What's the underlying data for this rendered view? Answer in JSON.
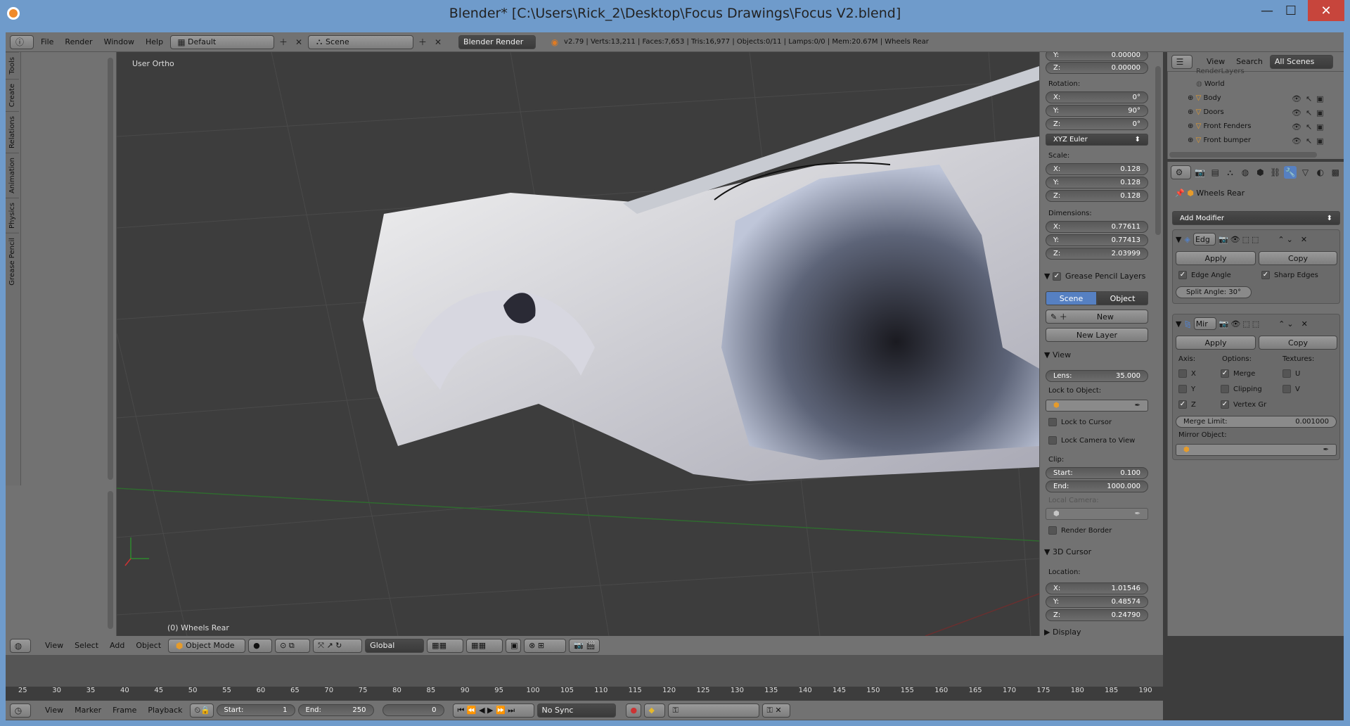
{
  "window": {
    "title": "Blender* [C:\\Users\\Rick_2\\Desktop\\Focus Drawings\\Focus V2.blend]",
    "minimize": "—",
    "maximize": "☐",
    "close": "✕"
  },
  "info_header": {
    "menus": [
      "File",
      "Render",
      "Window",
      "Help"
    ],
    "layout": "Default",
    "scene": "Scene",
    "engine": "Blender Render",
    "stats": "v2.79 | Verts:13,211 | Faces:7,653 | Tris:16,977 | Objects:0/11 | Lamps:0/0 | Mem:20.67M | Wheels Rear"
  },
  "toolshelf_tabs": [
    "Tools",
    "Create",
    "Relations",
    "Animation",
    "Physics",
    "Grease Pencil"
  ],
  "viewport": {
    "view_label": "User Ortho",
    "object_label": "(0) Wheels Rear"
  },
  "npanel": {
    "top_y": "0.00000",
    "top_z": "0.00000",
    "rotation_label": "Rotation:",
    "rotation": [
      {
        "axis": "X:",
        "value": "0°"
      },
      {
        "axis": "Y:",
        "value": "90°"
      },
      {
        "axis": "Z:",
        "value": "0°"
      }
    ],
    "rotation_mode": "XYZ Euler",
    "scale_label": "Scale:",
    "scale": [
      {
        "axis": "X:",
        "value": "0.128"
      },
      {
        "axis": "Y:",
        "value": "0.128"
      },
      {
        "axis": "Z:",
        "value": "0.128"
      }
    ],
    "dimensions_label": "Dimensions:",
    "dimensions": [
      {
        "axis": "X:",
        "value": "0.77611"
      },
      {
        "axis": "Y:",
        "value": "0.77413"
      },
      {
        "axis": "Z:",
        "value": "2.03999"
      }
    ],
    "grease_pencil": "Grease Pencil Layers",
    "scene_btn": "Scene",
    "object_btn": "Object",
    "new_btn": "New",
    "new_layer_btn": "New Layer",
    "view_section": "View",
    "lens_label": "Lens:",
    "lens_value": "35.000",
    "lock_to_object": "Lock to Object:",
    "lock_to_cursor": "Lock to Cursor",
    "lock_camera": "Lock Camera to View",
    "clip_label": "Clip:",
    "clip_start_label": "Start:",
    "clip_start": "0.100",
    "clip_end_label": "End:",
    "clip_end": "1000.000",
    "local_camera": "Local Camera:",
    "render_border": "Render Border",
    "cursor_section": "3D Cursor",
    "location_label": "Location:",
    "cursor": [
      {
        "axis": "X:",
        "value": "1.01546"
      },
      {
        "axis": "Y:",
        "value": "0.48574"
      },
      {
        "axis": "Z:",
        "value": "0.24790"
      }
    ],
    "display_section": "Display"
  },
  "outliner": {
    "view": "View",
    "search": "Search",
    "filter": "All Scenes",
    "items": [
      "RenderLayers",
      "World",
      "Body",
      "Doors",
      "Front Fenders",
      "Front bumper"
    ]
  },
  "properties": {
    "object": "Wheels Rear",
    "add_modifier": "Add Modifier",
    "mod1_name": "Edg",
    "mod2_name": "Mir",
    "apply": "Apply",
    "copy": "Copy",
    "edge_angle": "Edge Angle",
    "sharp_edges": "Sharp Edges",
    "split_angle": "Split Angle: 30°",
    "axis_label": "Axis:",
    "options_label": "Options:",
    "textures_label": "Textures:",
    "axis_x": "X",
    "axis_y": "Y",
    "axis_z": "Z",
    "merge": "Merge",
    "clipping": "Clipping",
    "vertex_gr": "Vertex Gr",
    "tex_u": "U",
    "tex_v": "V",
    "merge_limit_label": "Merge Limit:",
    "merge_limit": "0.001000",
    "mirror_object": "Mirror Object:"
  },
  "view3d_header": {
    "menus": [
      "View",
      "Select",
      "Add",
      "Object"
    ],
    "mode": "Object Mode",
    "orientation": "Global"
  },
  "timeline": {
    "ticks": [
      "25",
      "30",
      "35",
      "40",
      "45",
      "50",
      "55",
      "60",
      "65",
      "70",
      "75",
      "80",
      "85",
      "90",
      "95",
      "100",
      "105",
      "110",
      "115",
      "120",
      "125",
      "130",
      "135",
      "140",
      "145",
      "150",
      "155",
      "160",
      "165",
      "170",
      "175",
      "180",
      "185",
      "190"
    ],
    "menus": [
      "View",
      "Marker",
      "Frame",
      "Playback"
    ],
    "start_label": "Start:",
    "start": "1",
    "end_label": "End:",
    "end": "250",
    "current": "0",
    "sync": "No Sync"
  }
}
